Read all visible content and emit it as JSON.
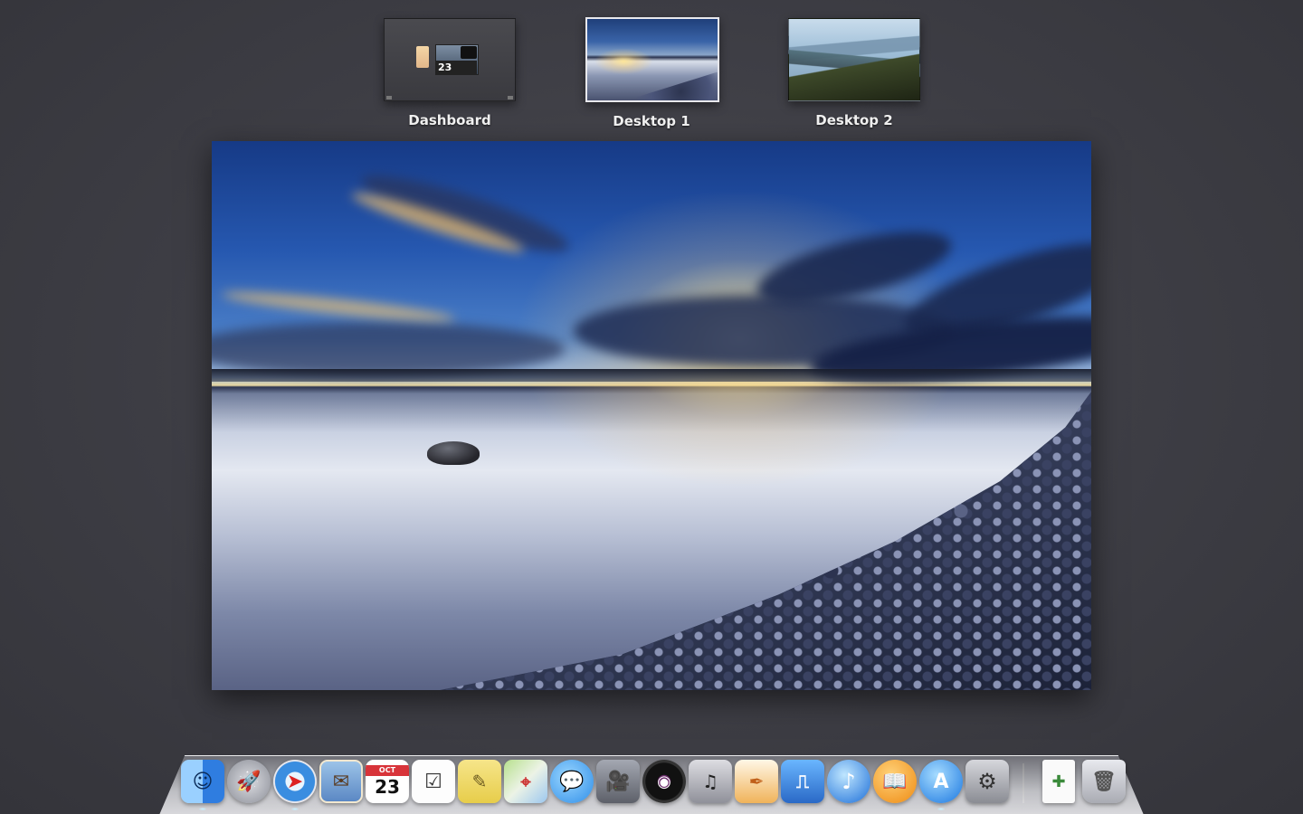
{
  "spaces": [
    {
      "name": "Dashboard",
      "active": false,
      "calendar_day": "23"
    },
    {
      "name": "Desktop 1",
      "active": true
    },
    {
      "name": "Desktop 2",
      "active": false
    }
  ],
  "dock": {
    "apps": [
      {
        "name": "finder-icon",
        "glyph": "☺"
      },
      {
        "name": "launchpad-icon",
        "glyph": "🚀"
      },
      {
        "name": "safari-icon",
        "glyph": "➤"
      },
      {
        "name": "mail-icon",
        "glyph": "✉"
      },
      {
        "name": "calendar-icon",
        "month": "OCT",
        "day": "23"
      },
      {
        "name": "reminders-icon",
        "glyph": "☑"
      },
      {
        "name": "notes-icon",
        "glyph": "✎"
      },
      {
        "name": "maps-icon",
        "glyph": "⌖"
      },
      {
        "name": "messages-icon",
        "glyph": "💬"
      },
      {
        "name": "facetime-icon",
        "glyph": "🎥"
      },
      {
        "name": "photo-booth-icon",
        "glyph": "◉"
      },
      {
        "name": "logic-icon",
        "glyph": "♫"
      },
      {
        "name": "pages-icon",
        "glyph": "✒"
      },
      {
        "name": "keynote-icon",
        "glyph": "⎍"
      },
      {
        "name": "itunes-icon",
        "glyph": "♪"
      },
      {
        "name": "ibooks-icon",
        "glyph": "📖"
      },
      {
        "name": "app-store-icon",
        "glyph": "A"
      },
      {
        "name": "system-preferences-icon",
        "glyph": "⚙"
      },
      {
        "name": "document-icon",
        "glyph": "✚"
      },
      {
        "name": "trash-icon",
        "glyph": "🗑"
      }
    ]
  }
}
